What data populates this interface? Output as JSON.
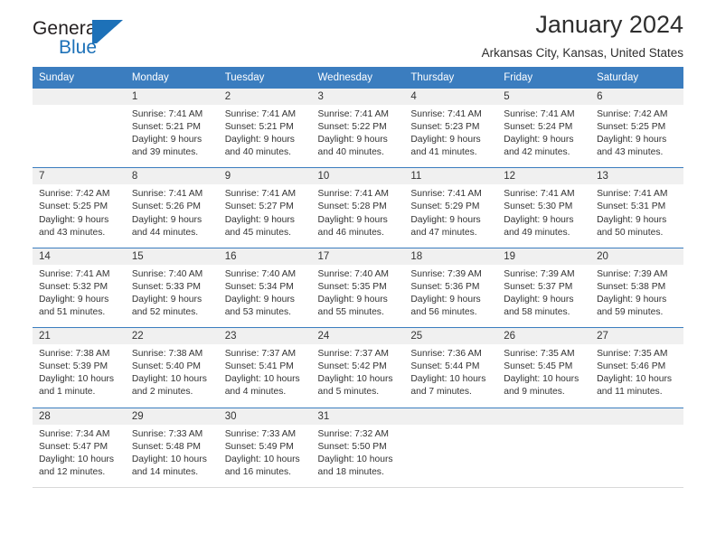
{
  "brand": {
    "name_part1": "General",
    "name_part2": "Blue",
    "logo_icon": "blue-flag-triangle-icon"
  },
  "header": {
    "month_title": "January 2024",
    "location": "Arkansas City, Kansas, United States"
  },
  "calendar": {
    "accent_color": "#3b7dbf",
    "daynum_band_color": "#f0f0f0",
    "weekday_headers": [
      "Sunday",
      "Monday",
      "Tuesday",
      "Wednesday",
      "Thursday",
      "Friday",
      "Saturday"
    ],
    "weeks": [
      [
        {
          "day": "",
          "lines": []
        },
        {
          "day": "1",
          "lines": [
            "Sunrise: 7:41 AM",
            "Sunset: 5:21 PM",
            "Daylight: 9 hours",
            "and 39 minutes."
          ]
        },
        {
          "day": "2",
          "lines": [
            "Sunrise: 7:41 AM",
            "Sunset: 5:21 PM",
            "Daylight: 9 hours",
            "and 40 minutes."
          ]
        },
        {
          "day": "3",
          "lines": [
            "Sunrise: 7:41 AM",
            "Sunset: 5:22 PM",
            "Daylight: 9 hours",
            "and 40 minutes."
          ]
        },
        {
          "day": "4",
          "lines": [
            "Sunrise: 7:41 AM",
            "Sunset: 5:23 PM",
            "Daylight: 9 hours",
            "and 41 minutes."
          ]
        },
        {
          "day": "5",
          "lines": [
            "Sunrise: 7:41 AM",
            "Sunset: 5:24 PM",
            "Daylight: 9 hours",
            "and 42 minutes."
          ]
        },
        {
          "day": "6",
          "lines": [
            "Sunrise: 7:42 AM",
            "Sunset: 5:25 PM",
            "Daylight: 9 hours",
            "and 43 minutes."
          ]
        }
      ],
      [
        {
          "day": "7",
          "lines": [
            "Sunrise: 7:42 AM",
            "Sunset: 5:25 PM",
            "Daylight: 9 hours",
            "and 43 minutes."
          ]
        },
        {
          "day": "8",
          "lines": [
            "Sunrise: 7:41 AM",
            "Sunset: 5:26 PM",
            "Daylight: 9 hours",
            "and 44 minutes."
          ]
        },
        {
          "day": "9",
          "lines": [
            "Sunrise: 7:41 AM",
            "Sunset: 5:27 PM",
            "Daylight: 9 hours",
            "and 45 minutes."
          ]
        },
        {
          "day": "10",
          "lines": [
            "Sunrise: 7:41 AM",
            "Sunset: 5:28 PM",
            "Daylight: 9 hours",
            "and 46 minutes."
          ]
        },
        {
          "day": "11",
          "lines": [
            "Sunrise: 7:41 AM",
            "Sunset: 5:29 PM",
            "Daylight: 9 hours",
            "and 47 minutes."
          ]
        },
        {
          "day": "12",
          "lines": [
            "Sunrise: 7:41 AM",
            "Sunset: 5:30 PM",
            "Daylight: 9 hours",
            "and 49 minutes."
          ]
        },
        {
          "day": "13",
          "lines": [
            "Sunrise: 7:41 AM",
            "Sunset: 5:31 PM",
            "Daylight: 9 hours",
            "and 50 minutes."
          ]
        }
      ],
      [
        {
          "day": "14",
          "lines": [
            "Sunrise: 7:41 AM",
            "Sunset: 5:32 PM",
            "Daylight: 9 hours",
            "and 51 minutes."
          ]
        },
        {
          "day": "15",
          "lines": [
            "Sunrise: 7:40 AM",
            "Sunset: 5:33 PM",
            "Daylight: 9 hours",
            "and 52 minutes."
          ]
        },
        {
          "day": "16",
          "lines": [
            "Sunrise: 7:40 AM",
            "Sunset: 5:34 PM",
            "Daylight: 9 hours",
            "and 53 minutes."
          ]
        },
        {
          "day": "17",
          "lines": [
            "Sunrise: 7:40 AM",
            "Sunset: 5:35 PM",
            "Daylight: 9 hours",
            "and 55 minutes."
          ]
        },
        {
          "day": "18",
          "lines": [
            "Sunrise: 7:39 AM",
            "Sunset: 5:36 PM",
            "Daylight: 9 hours",
            "and 56 minutes."
          ]
        },
        {
          "day": "19",
          "lines": [
            "Sunrise: 7:39 AM",
            "Sunset: 5:37 PM",
            "Daylight: 9 hours",
            "and 58 minutes."
          ]
        },
        {
          "day": "20",
          "lines": [
            "Sunrise: 7:39 AM",
            "Sunset: 5:38 PM",
            "Daylight: 9 hours",
            "and 59 minutes."
          ]
        }
      ],
      [
        {
          "day": "21",
          "lines": [
            "Sunrise: 7:38 AM",
            "Sunset: 5:39 PM",
            "Daylight: 10 hours",
            "and 1 minute."
          ]
        },
        {
          "day": "22",
          "lines": [
            "Sunrise: 7:38 AM",
            "Sunset: 5:40 PM",
            "Daylight: 10 hours",
            "and 2 minutes."
          ]
        },
        {
          "day": "23",
          "lines": [
            "Sunrise: 7:37 AM",
            "Sunset: 5:41 PM",
            "Daylight: 10 hours",
            "and 4 minutes."
          ]
        },
        {
          "day": "24",
          "lines": [
            "Sunrise: 7:37 AM",
            "Sunset: 5:42 PM",
            "Daylight: 10 hours",
            "and 5 minutes."
          ]
        },
        {
          "day": "25",
          "lines": [
            "Sunrise: 7:36 AM",
            "Sunset: 5:44 PM",
            "Daylight: 10 hours",
            "and 7 minutes."
          ]
        },
        {
          "day": "26",
          "lines": [
            "Sunrise: 7:35 AM",
            "Sunset: 5:45 PM",
            "Daylight: 10 hours",
            "and 9 minutes."
          ]
        },
        {
          "day": "27",
          "lines": [
            "Sunrise: 7:35 AM",
            "Sunset: 5:46 PM",
            "Daylight: 10 hours",
            "and 11 minutes."
          ]
        }
      ],
      [
        {
          "day": "28",
          "lines": [
            "Sunrise: 7:34 AM",
            "Sunset: 5:47 PM",
            "Daylight: 10 hours",
            "and 12 minutes."
          ]
        },
        {
          "day": "29",
          "lines": [
            "Sunrise: 7:33 AM",
            "Sunset: 5:48 PM",
            "Daylight: 10 hours",
            "and 14 minutes."
          ]
        },
        {
          "day": "30",
          "lines": [
            "Sunrise: 7:33 AM",
            "Sunset: 5:49 PM",
            "Daylight: 10 hours",
            "and 16 minutes."
          ]
        },
        {
          "day": "31",
          "lines": [
            "Sunrise: 7:32 AM",
            "Sunset: 5:50 PM",
            "Daylight: 10 hours",
            "and 18 minutes."
          ]
        },
        {
          "day": "",
          "lines": []
        },
        {
          "day": "",
          "lines": []
        },
        {
          "day": "",
          "lines": []
        }
      ]
    ]
  }
}
